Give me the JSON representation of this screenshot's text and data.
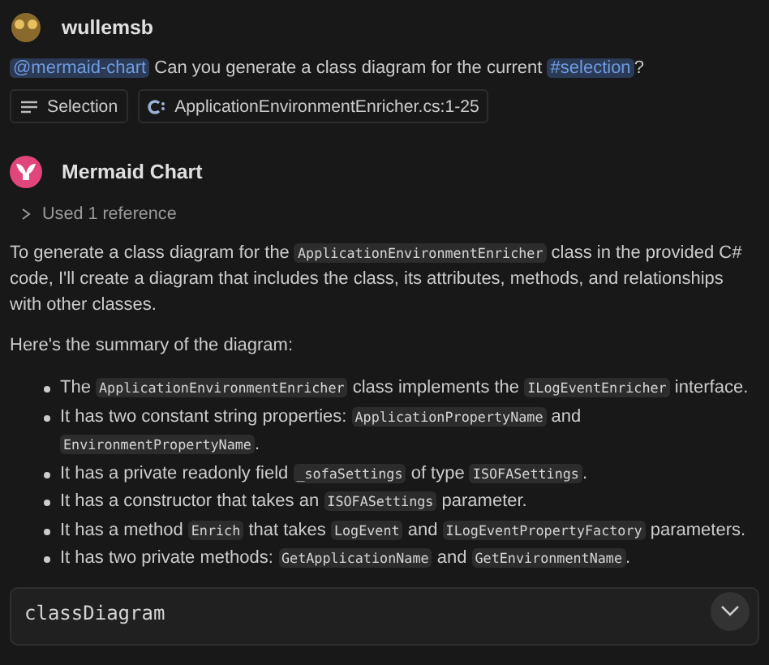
{
  "user": {
    "name": "wullemsb",
    "message": [
      {
        "kind": "mention",
        "text": "@mermaid-chart"
      },
      {
        "kind": "text",
        "text": " Can you generate a class diagram for the current "
      },
      {
        "kind": "mention",
        "text": "#selection"
      },
      {
        "kind": "text",
        "text": "?"
      }
    ],
    "attachments": [
      {
        "kind": "selection",
        "label": "Selection"
      },
      {
        "kind": "file",
        "label": "ApplicationEnvironmentEnricher.cs:1-25"
      }
    ]
  },
  "assistant": {
    "name": "Mermaid Chart",
    "references": {
      "label": "Used 1 reference",
      "expanded": false
    },
    "paragraphs": [
      [
        {
          "kind": "text",
          "text": "To generate a class diagram for the "
        },
        {
          "kind": "code",
          "text": "ApplicationEnvironmentEnricher"
        },
        {
          "kind": "text",
          "text": " class in the provided C# code, I'll create a diagram that includes the class, its attributes, methods, and relationships with other classes."
        }
      ],
      [
        {
          "kind": "text",
          "text": "Here's the summary of the diagram:"
        }
      ]
    ],
    "bullets": [
      [
        {
          "kind": "text",
          "text": "The "
        },
        {
          "kind": "code",
          "text": "ApplicationEnvironmentEnricher"
        },
        {
          "kind": "text",
          "text": " class implements the "
        },
        {
          "kind": "code",
          "text": "ILogEventEnricher"
        },
        {
          "kind": "text",
          "text": " interface."
        }
      ],
      [
        {
          "kind": "text",
          "text": "It has two constant string properties: "
        },
        {
          "kind": "code",
          "text": "ApplicationPropertyName"
        },
        {
          "kind": "text",
          "text": " and "
        },
        {
          "kind": "code",
          "text": "EnvironmentPropertyName"
        },
        {
          "kind": "text",
          "text": "."
        }
      ],
      [
        {
          "kind": "text",
          "text": "It has a private readonly field "
        },
        {
          "kind": "code",
          "text": "_sofaSettings"
        },
        {
          "kind": "text",
          "text": " of type "
        },
        {
          "kind": "code",
          "text": "ISOFASettings"
        },
        {
          "kind": "text",
          "text": "."
        }
      ],
      [
        {
          "kind": "text",
          "text": "It has a constructor that takes an "
        },
        {
          "kind": "code",
          "text": "ISOFASettings"
        },
        {
          "kind": "text",
          "text": " parameter."
        }
      ],
      [
        {
          "kind": "text",
          "text": "It has a method "
        },
        {
          "kind": "code",
          "text": "Enrich"
        },
        {
          "kind": "text",
          "text": " that takes "
        },
        {
          "kind": "code",
          "text": "LogEvent"
        },
        {
          "kind": "text",
          "text": " and "
        },
        {
          "kind": "code",
          "text": "ILogEventPropertyFactory"
        },
        {
          "kind": "text",
          "text": " parameters."
        }
      ],
      [
        {
          "kind": "text",
          "text": "It has two private methods: "
        },
        {
          "kind": "code",
          "text": "GetApplicationName"
        },
        {
          "kind": "text",
          "text": " and "
        },
        {
          "kind": "code",
          "text": "GetEnvironmentName"
        },
        {
          "kind": "text",
          "text": "."
        }
      ]
    ],
    "code_block": {
      "lines": [
        "classDiagram"
      ]
    }
  }
}
